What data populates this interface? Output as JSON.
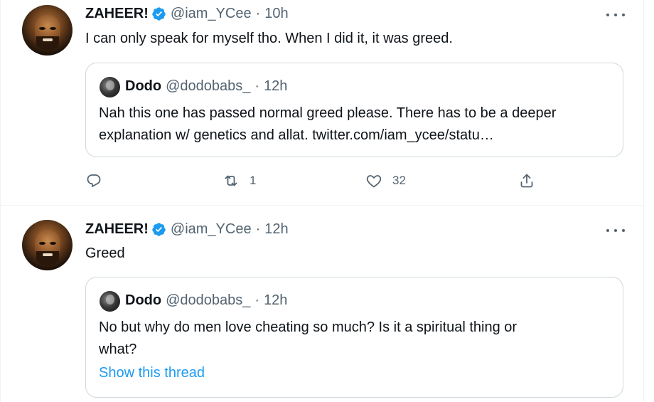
{
  "tweets": [
    {
      "author": {
        "name": "ZAHEER!",
        "handle": "@iam_YCee",
        "verified": true
      },
      "time": "10h",
      "text": "I can only speak for myself tho. When I did it, it was greed.",
      "quote": {
        "author": {
          "name": "Dodo",
          "handle": "@dodobabs_"
        },
        "time": "12h",
        "lines": [
          "Nah this one has passed normal greed please. There has to be a deeper",
          "explanation w/ genetics and allat. twitter.com/iam_ycee/statu…"
        ]
      },
      "actions": {
        "reply_count": "",
        "retweet_count": "1",
        "like_count": "32"
      }
    },
    {
      "author": {
        "name": "ZAHEER!",
        "handle": "@iam_YCee",
        "verified": true
      },
      "time": "12h",
      "text": "Greed",
      "quote": {
        "author": {
          "name": "Dodo",
          "handle": "@dodobabs_"
        },
        "time": "12h",
        "lines": [
          "No but why do men love cheating so much? Is it a spiritual thing or",
          "what?"
        ],
        "show_thread": "Show this thread"
      }
    }
  ],
  "separator": "·",
  "colors": {
    "accent": "#1d9bf0",
    "secondary_text": "#536471",
    "border": "#cfd9de"
  },
  "icons": [
    "verified-badge-icon",
    "more-icon",
    "reply-icon",
    "retweet-icon",
    "like-icon",
    "share-icon"
  ]
}
